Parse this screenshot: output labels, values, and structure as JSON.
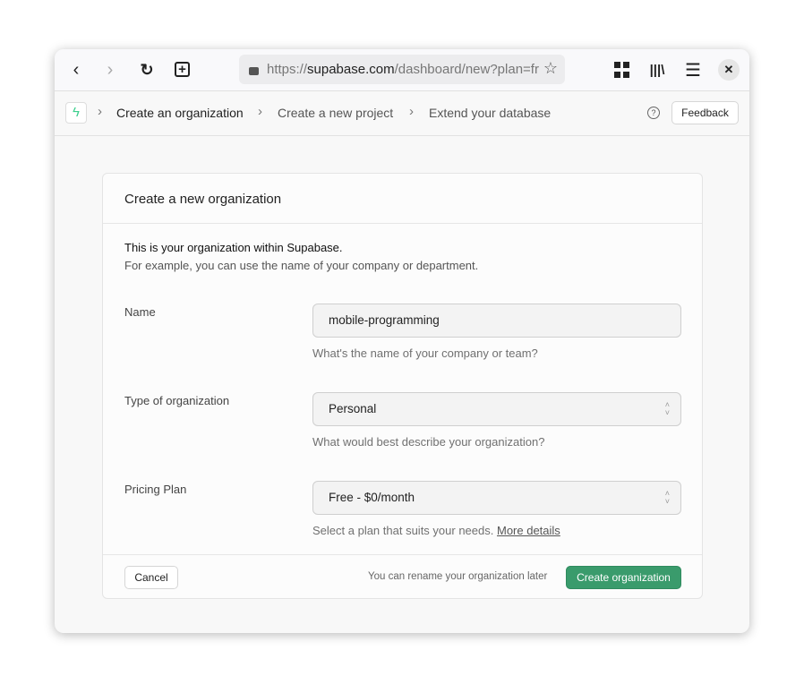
{
  "browser": {
    "url_prefix": "https://",
    "url_domain": "supabase.com",
    "url_path": "/dashboard/new?plan=fr",
    "icons": [
      "back-icon",
      "forward-icon",
      "reload-icon",
      "new-tab-icon",
      "lock-icon",
      "star-icon",
      "extensions-icon",
      "library-icon",
      "menu-icon",
      "close-icon"
    ]
  },
  "breadcrumb": {
    "items": [
      "Create an organization",
      "Create a new project",
      "Extend your database"
    ],
    "feedback": "Feedback"
  },
  "card": {
    "title": "Create a new organization",
    "intro1": "This is your organization within Supabase.",
    "intro2": "For example, you can use the name of your company or department.",
    "name": {
      "label": "Name",
      "value": "mobile-programming",
      "help": "What's the name of your company or team?"
    },
    "type": {
      "label": "Type of organization",
      "value": "Personal",
      "help": "What would best describe your organization?"
    },
    "plan": {
      "label": "Pricing Plan",
      "value": "Free - $0/month",
      "help": "Select a plan that suits your needs.",
      "link": "More details"
    },
    "cancel": "Cancel",
    "note": "You can rename your organization later",
    "submit": "Create organization"
  },
  "colors": {
    "accent": "#3a9b6c"
  }
}
